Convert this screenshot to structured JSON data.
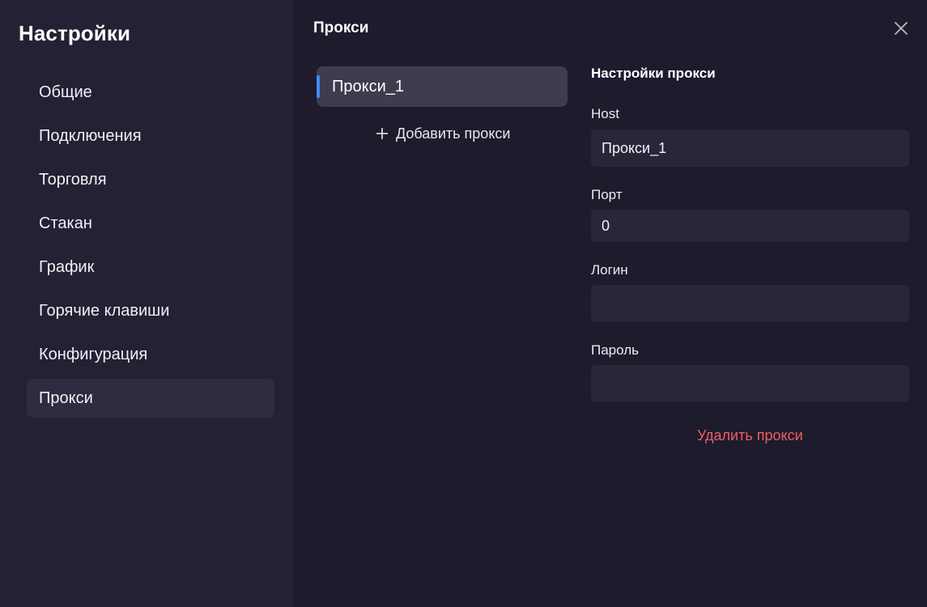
{
  "sidebar": {
    "title": "Настройки",
    "items": [
      {
        "label": "Общие"
      },
      {
        "label": "Подключения"
      },
      {
        "label": "Торговля"
      },
      {
        "label": "Стакан"
      },
      {
        "label": "График"
      },
      {
        "label": "Горячие клавиши"
      },
      {
        "label": "Конфигурация"
      },
      {
        "label": "Прокси",
        "active": true
      }
    ]
  },
  "header": {
    "title": "Прокси",
    "close_icon": "close-icon"
  },
  "proxies": {
    "items": [
      {
        "label": "Прокси_1",
        "selected": true
      }
    ],
    "add_label": "Добавить прокси",
    "add_icon": "plus-icon"
  },
  "form": {
    "title": "Настройки прокси",
    "host": {
      "label": "Host",
      "value": "Прокси_1"
    },
    "port": {
      "label": "Порт",
      "value": "0"
    },
    "login": {
      "label": "Логин",
      "value": ""
    },
    "password": {
      "label": "Пароль",
      "value": ""
    },
    "delete_label": "Удалить прокси"
  },
  "colors": {
    "sidebar_bg": "#232134",
    "main_bg": "#1d1b2c",
    "accent": "#3d8ef2",
    "danger": "#ee5d63",
    "input_bg": "#29263a"
  }
}
